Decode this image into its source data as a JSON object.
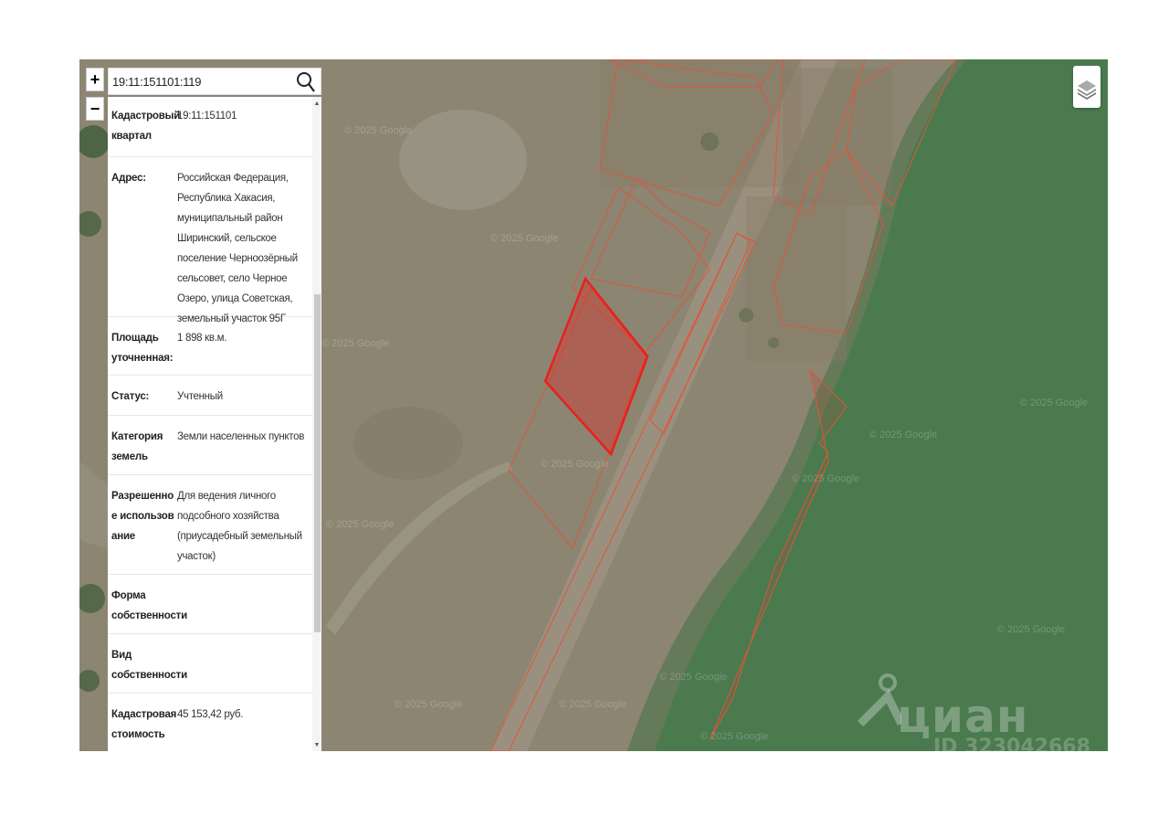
{
  "search": {
    "value": "19:11:151101:119"
  },
  "zoom": {
    "in_label": "+",
    "out_label": "−"
  },
  "parcel_info": [
    {
      "label": "Кадастровый квартал",
      "value": "19:11:151101"
    },
    {
      "label": "Адрес:",
      "value": "Российская Федерация, Республика Хакасия, муниципальный район Ширинский, сельское поселение Черноозёрный сельсовет, село Черное Озеро, улица Советская, земельный участок 95Г"
    },
    {
      "label": "Площадь уточненная:",
      "value": "1 898 кв.м."
    },
    {
      "label": "Статус:",
      "value": "Учтенный"
    },
    {
      "label": "Категория земель",
      "value": "Земли населенных пунктов"
    },
    {
      "label": "Разрешенное использование",
      "value": "Для ведения личного подсобного хозяйства (приусадебный земельный участок)"
    },
    {
      "label": "Форма собственности",
      "value": ""
    },
    {
      "label": "Вид собственности",
      "value": ""
    },
    {
      "label": "Кадастровая стоимость",
      "value": "45 153,42 руб."
    }
  ],
  "map": {
    "watermark": "© 2025 Google",
    "brand": "циан",
    "brand_id": "ID 323042668",
    "colors": {
      "land": "#8a8470",
      "water": "#4a7a4e",
      "parcel_outline": "#e0553a",
      "selected_parcel": "#e8201e"
    }
  },
  "icons": {
    "search": "search-icon",
    "layers": "layers-icon",
    "location": "location-pin-icon"
  }
}
